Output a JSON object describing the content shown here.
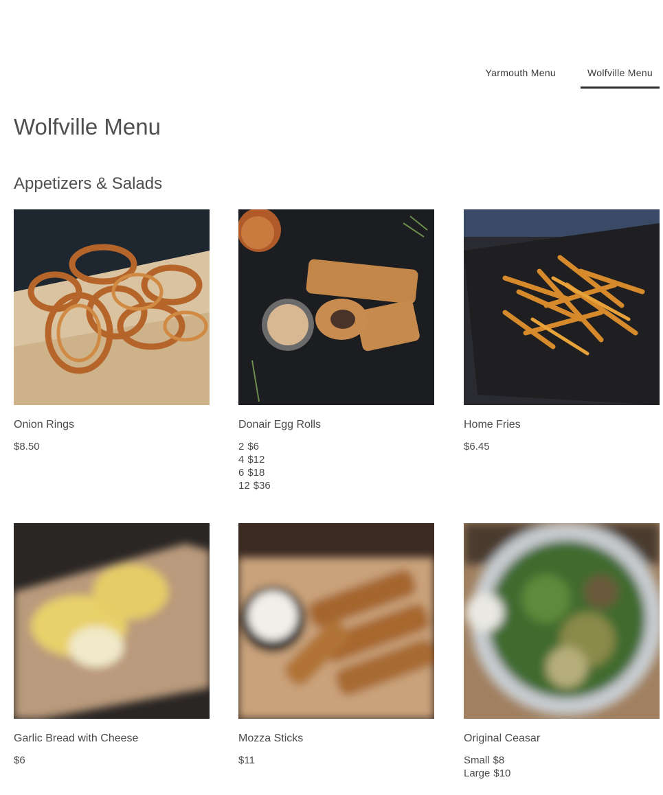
{
  "nav": {
    "tabs": [
      {
        "label": "Yarmouth Menu",
        "active": false
      },
      {
        "label": "Wolfville Menu",
        "active": true
      }
    ]
  },
  "page": {
    "title": "Wolfville Menu"
  },
  "section": {
    "title": "Appetizers & Salads"
  },
  "items": [
    {
      "name": "Onion Rings",
      "prices": [
        {
          "label": "",
          "price": "$8.50"
        }
      ]
    },
    {
      "name": "Donair Egg Rolls",
      "prices": [
        {
          "label": "2",
          "price": "$6"
        },
        {
          "label": "4",
          "price": "$12"
        },
        {
          "label": "6",
          "price": "$18"
        },
        {
          "label": "12",
          "price": "$36"
        }
      ]
    },
    {
      "name": "Home Fries",
      "prices": [
        {
          "label": "",
          "price": "$6.45"
        }
      ]
    },
    {
      "name": "Garlic Bread with Cheese",
      "prices": [
        {
          "label": "",
          "price": "$6"
        }
      ]
    },
    {
      "name": "Mozza Sticks",
      "prices": [
        {
          "label": "",
          "price": "$11"
        }
      ]
    },
    {
      "name": "Original Ceasar",
      "prices": [
        {
          "label": "Small",
          "price": "$8"
        },
        {
          "label": "Large",
          "price": "$10"
        }
      ]
    }
  ]
}
